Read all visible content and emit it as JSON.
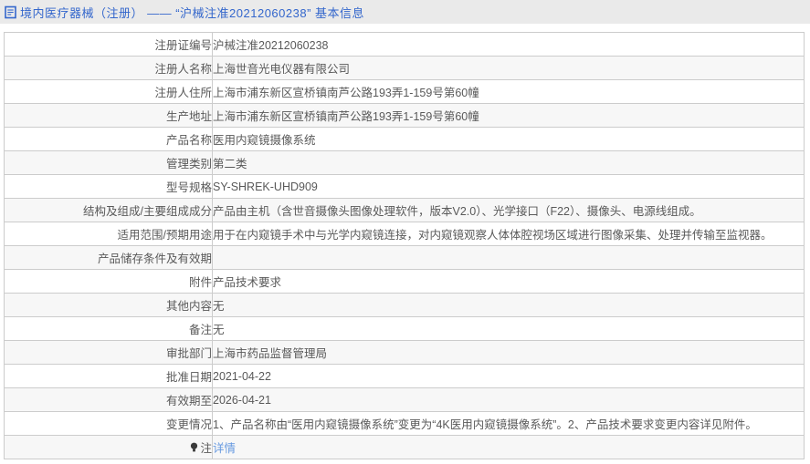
{
  "header": {
    "title": "境内医疗器械（注册） —— “沪械注准20212060238” 基本信息"
  },
  "colors": {
    "accent_blue": "#3366cc",
    "link_blue": "#6699e0",
    "header_bg": "#eaeaea",
    "alt_row_bg": "#f7f7f7",
    "border": "#cccccc",
    "text": "#595959"
  },
  "table": {
    "rows": [
      {
        "label": "注册证编号",
        "value": "沪械注准20212060238"
      },
      {
        "label": "注册人名称",
        "value": "上海世音光电仪器有限公司"
      },
      {
        "label": "注册人住所",
        "value": "上海市浦东新区宣桥镇南芦公路193弄1-159号第60幢"
      },
      {
        "label": "生产地址",
        "value": "上海市浦东新区宣桥镇南芦公路193弄1-159号第60幢"
      },
      {
        "label": "产品名称",
        "value": "医用内窥镜摄像系统"
      },
      {
        "label": "管理类别",
        "value": "第二类"
      },
      {
        "label": "型号规格",
        "value": "SY-SHREK-UHD909"
      },
      {
        "label": "结构及组成/主要组成成分",
        "value": "产品由主机（含世音摄像头图像处理软件，版本V2.0）、光学接口（F22）、摄像头、电源线组成。"
      },
      {
        "label": "适用范围/预期用途",
        "value": "用于在内窥镜手术中与光学内窥镜连接，对内窥镜观察人体体腔视场区域进行图像采集、处理并传输至监视器。"
      },
      {
        "label": "产品储存条件及有效期",
        "value": ""
      },
      {
        "label": "附件",
        "value": "产品技术要求"
      },
      {
        "label": "其他内容",
        "value": "无"
      },
      {
        "label": "备注",
        "value": "无"
      },
      {
        "label": "审批部门",
        "value": "上海市药品监督管理局"
      },
      {
        "label": "批准日期",
        "value": "2021-04-22"
      },
      {
        "label": "有效期至",
        "value": "2026-04-21"
      },
      {
        "label": "变更情况",
        "value": "1、产品名称由“医用内窥镜摄像系统”变更为“4K医用内窥镜摄像系统”。2、产品技术要求变更内容详见附件。"
      },
      {
        "label": "注",
        "value": "详情",
        "link": true,
        "icon": "bulb-icon"
      }
    ]
  }
}
